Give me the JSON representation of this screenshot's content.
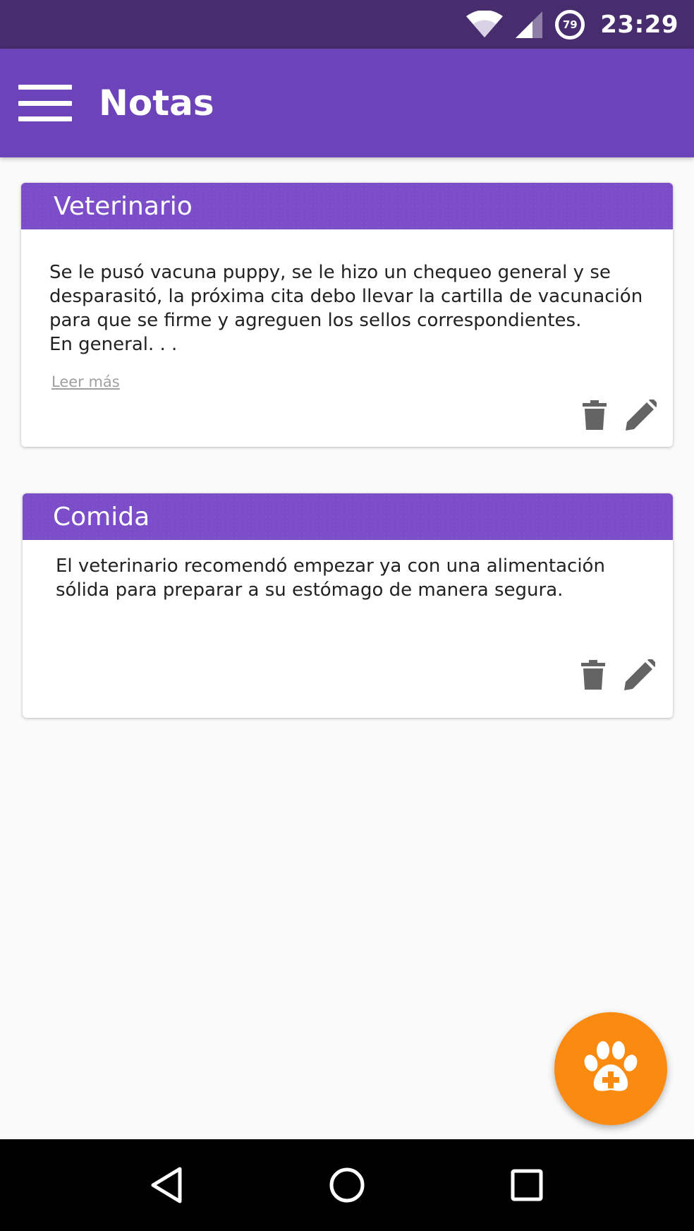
{
  "status_bar": {
    "wifi_icon": "wifi-icon",
    "signal_icon": "cell-signal-icon",
    "battery_level": "79",
    "time": "23:29"
  },
  "app_bar": {
    "menu_icon": "hamburger-menu-icon",
    "title": "Notas"
  },
  "notes": [
    {
      "title": "Veterinario",
      "body": "Se le pusó vacuna puppy, se le hizo un chequeo general y se\ndesparasitó, la próxima cita debo llevar la cartilla de vacunación\npara que se firme y agreguen los sellos correspondientes.\nEn general. . .",
      "read_more": "Leer más",
      "delete_icon": "trash-icon",
      "edit_icon": "pencil-icon"
    },
    {
      "title": "Comida",
      "body": "El veterinario recomendó empezar ya con una alimentación\nsólida para preparar a su estómago de manera segura.",
      "delete_icon": "trash-icon",
      "edit_icon": "pencil-icon"
    }
  ],
  "fab": {
    "icon": "paw-plus-icon"
  },
  "nav_bar": {
    "back_icon": "back-triangle-icon",
    "home_icon": "home-circle-icon",
    "recents_icon": "recents-square-icon"
  },
  "colors": {
    "status_bar": "#472d6e",
    "app_bar": "#6c43b9",
    "card_header": "#7b4dc9",
    "fab": "#fb8b10",
    "icon_gray": "#646464"
  }
}
